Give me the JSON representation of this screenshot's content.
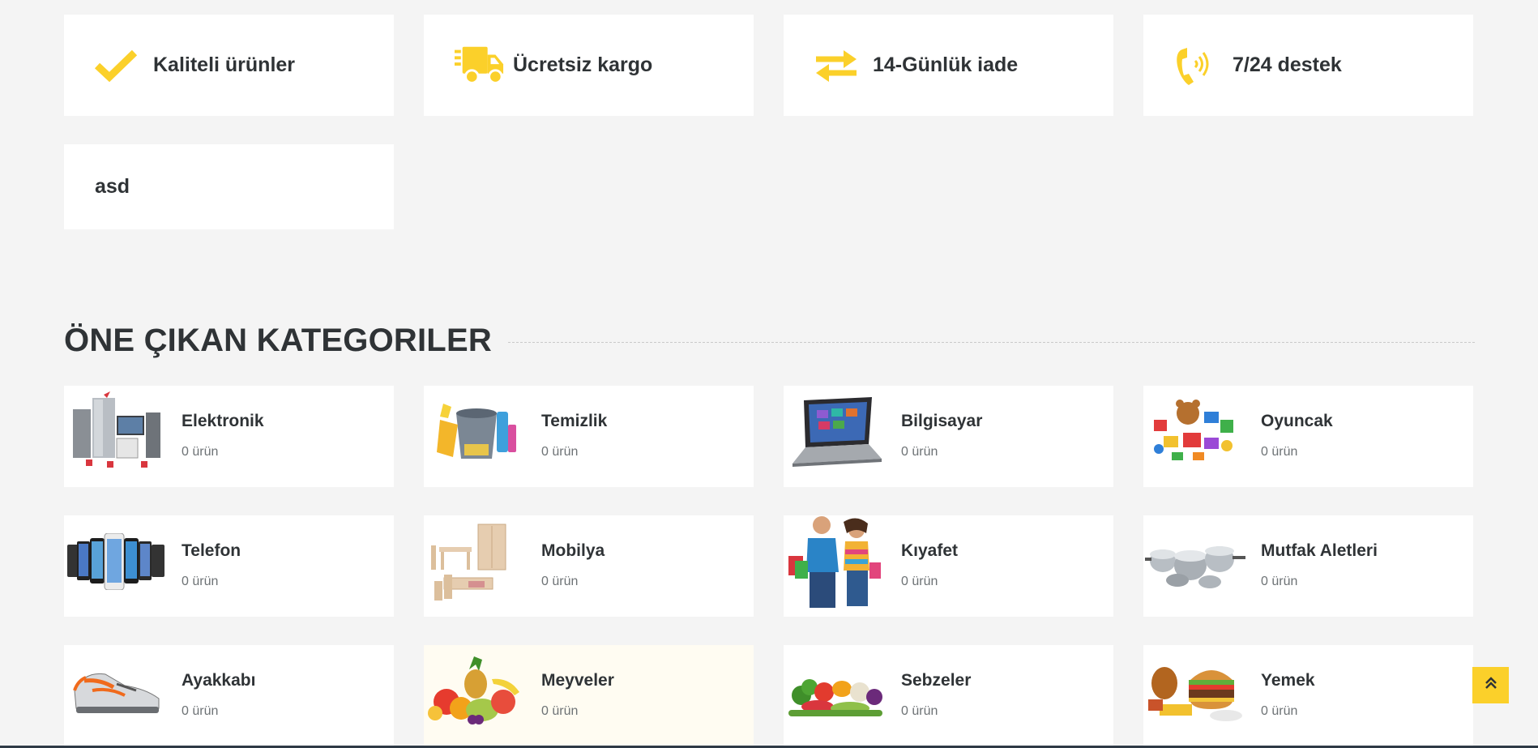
{
  "features": [
    {
      "label": "Kaliteli ürünler",
      "icon": "check-icon"
    },
    {
      "label": "Ücretsiz kargo",
      "icon": "truck-icon"
    },
    {
      "label": "14-Günlük iade",
      "icon": "exchange-arrows-icon"
    },
    {
      "label": "7/24 destek",
      "icon": "phone-icon"
    },
    {
      "label": "asd",
      "icon": ""
    }
  ],
  "section_title": "ÖNE ÇIKAN KATEGORILER",
  "categories": [
    {
      "name": "Elektronik",
      "count": "0 ürün"
    },
    {
      "name": "Temizlik",
      "count": "0 ürün"
    },
    {
      "name": "Bilgisayar",
      "count": "0 ürün"
    },
    {
      "name": "Oyuncak",
      "count": "0 ürün"
    },
    {
      "name": "Telefon",
      "count": "0 ürün"
    },
    {
      "name": "Mobilya",
      "count": "0 ürün"
    },
    {
      "name": "Kıyafet",
      "count": "0 ürün"
    },
    {
      "name": "Mutfak Aletleri",
      "count": "0 ürün"
    },
    {
      "name": "Ayakkabı",
      "count": "0 ürün"
    },
    {
      "name": "Meyveler",
      "count": "0 ürün"
    },
    {
      "name": "Sebzeler",
      "count": "0 ürün"
    },
    {
      "name": "Yemek",
      "count": "0 ürün"
    }
  ],
  "colors": {
    "accent": "#fbd02a",
    "background": "#f4f4f4",
    "card": "#ffffff",
    "text": "#2f3336",
    "muted": "#6d7275"
  }
}
